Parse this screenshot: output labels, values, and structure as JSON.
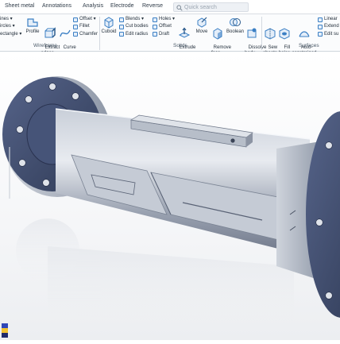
{
  "tabs": [
    "Sheet metal",
    "Annotations",
    "Analysis",
    "Electrode",
    "Reverse"
  ],
  "quick_search": {
    "placeholder": "Quick search"
  },
  "wireframe": {
    "group_label": "Wireframe",
    "list1": [
      "ines ▾",
      "ircles ▾",
      "ectangle ▾"
    ],
    "profile_label": "Profile",
    "extract_edges_label": "Extract\nedges ▾",
    "curve_label": "Curve\n▾",
    "list2": [
      "Offset ▾",
      "Fillet",
      "Chamfer"
    ]
  },
  "solids": {
    "group_label": "Solids",
    "cuboid_label": "Cuboid",
    "list3": [
      "Blends ▾",
      "Cut bodies",
      "Edit radius"
    ],
    "list4": [
      "Holes ▾",
      "Offset",
      "Draft"
    ],
    "extrude_label": "Extrude\n▾",
    "move_label": "Move",
    "remove_face_label": "Remove\nface ▾",
    "boolean_label": "Boolean",
    "dissolve_body_label": "Dissolve\nbody ▾"
  },
  "surfaces": {
    "group_label": "Surfaces",
    "sew_sheets_label": "Sew\nsheets",
    "fill_holes_label": "Fill\nholes",
    "auto_constrained_label": "Auto-\nconstrained",
    "list5": [
      "Linear",
      "Extend",
      "Edit su"
    ]
  },
  "colors": {
    "accent": "#3b7fc4",
    "part_metal": "#a9b1bf",
    "flange": "#3c4a6a"
  }
}
